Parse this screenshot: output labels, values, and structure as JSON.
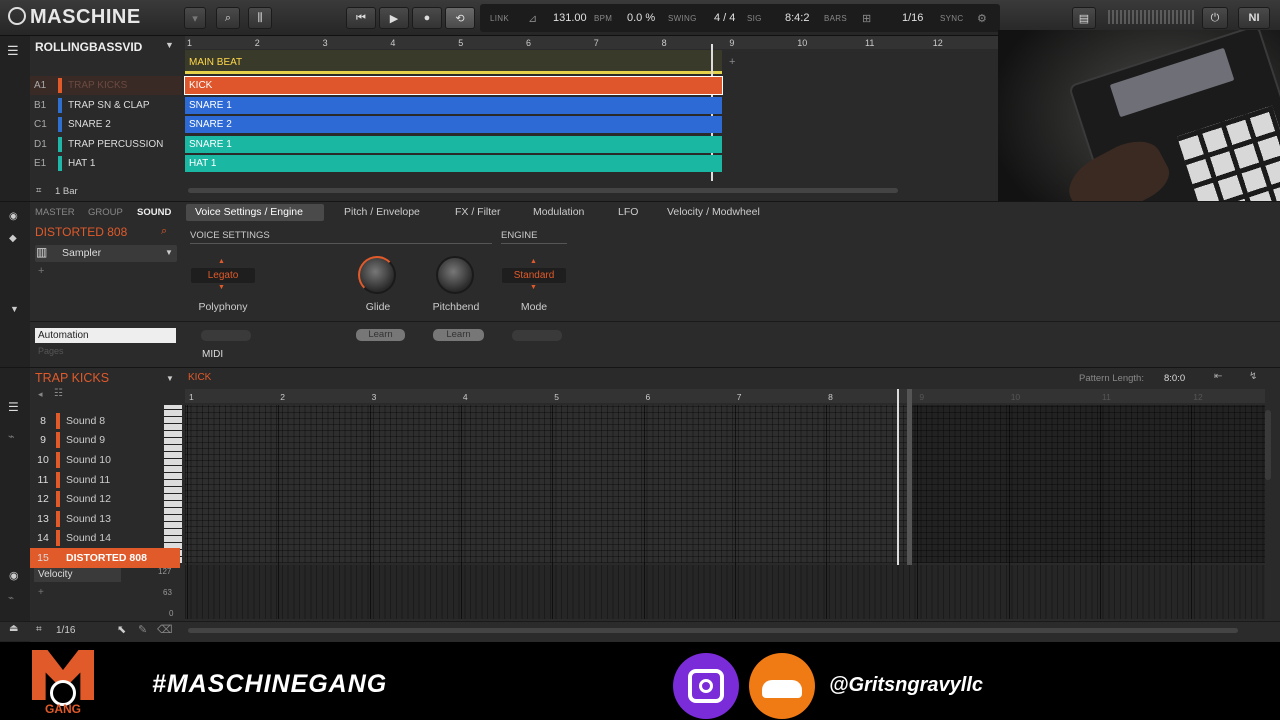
{
  "header": {
    "logo": "MASCHINE",
    "link": "LINK",
    "tempo": "131.00",
    "tempo_unit": "BPM",
    "swing": "0.0 %",
    "swing_label": "SWING",
    "sig": "4 / 4",
    "sig_label": "SIG",
    "position": "8:4:2",
    "position_label": "BARS",
    "quant": "1/16",
    "sync_label": "SYNC"
  },
  "arranger": {
    "project": "ROLLINGBASSVID",
    "bar_numbers": [
      "1",
      "2",
      "3",
      "4",
      "5",
      "6",
      "7",
      "8",
      "9",
      "10",
      "11",
      "12"
    ],
    "scene": "MAIN BEAT",
    "groups": [
      {
        "slot": "A1",
        "name": "TRAP KICKS",
        "color": "#e05a2a",
        "clip": "KICK",
        "clip_color": "#e0562c"
      },
      {
        "slot": "B1",
        "name": "TRAP SN & CLAP",
        "color": "#2f6fd0",
        "clip": "SNARE 1",
        "clip_color": "#2e6ad6"
      },
      {
        "slot": "C1",
        "name": "SNARE 2",
        "color": "#2f6fd0",
        "clip": "SNARE 2",
        "clip_color": "#2e6ad6"
      },
      {
        "slot": "D1",
        "name": "TRAP PERCUSSION",
        "color": "#1fb8a8",
        "clip": "SNARE 1",
        "clip_color": "#1ab8a3"
      },
      {
        "slot": "E1",
        "name": "HAT 1",
        "color": "#1fb8a8",
        "clip": "HAT 1",
        "clip_color": "#1ab8a3"
      }
    ],
    "bar_length": "1 Bar"
  },
  "sound": {
    "tabs_left": [
      "MASTER",
      "GROUP",
      "SOUND"
    ],
    "sound_name": "DISTORTED 808",
    "plugin": "Sampler",
    "tabs": [
      "Voice Settings / Engine",
      "Pitch / Envelope",
      "FX / Filter",
      "Modulation",
      "LFO",
      "Velocity / Modwheel"
    ],
    "section_voice": "VOICE SETTINGS",
    "section_engine": "ENGINE",
    "polyphony_value": "Legato",
    "polyphony_label": "Polyphony",
    "glide_label": "Glide",
    "pitchbend_label": "Pitchbend",
    "mode_value": "Standard",
    "mode_label": "Mode",
    "automation": "Automation",
    "pages": "Pages",
    "midi": "MIDI",
    "learn": "Learn"
  },
  "pattern": {
    "group": "TRAP KICKS",
    "pattern_name": "KICK",
    "length_label": "Pattern Length:",
    "length_value": "8:0:0",
    "bar_numbers": [
      "1",
      "2",
      "3",
      "4",
      "5",
      "6",
      "7",
      "8",
      "9",
      "10",
      "11",
      "12"
    ],
    "sounds": [
      {
        "num": "8",
        "name": "Sound 8"
      },
      {
        "num": "9",
        "name": "Sound 9"
      },
      {
        "num": "10",
        "name": "Sound 10"
      },
      {
        "num": "11",
        "name": "Sound 11"
      },
      {
        "num": "12",
        "name": "Sound 12"
      },
      {
        "num": "13",
        "name": "Sound 13"
      },
      {
        "num": "14",
        "name": "Sound 14"
      },
      {
        "num": "15",
        "name": "DISTORTED 808"
      }
    ],
    "velocity": "Velocity",
    "vel_127": "127",
    "vel_63": "63",
    "vel_0": "0",
    "grid": "1/16"
  },
  "footer": {
    "hashtag": "#MASCHINEGANG",
    "handle": "@Gritsngravyllc",
    "logo_text": "GANG"
  }
}
